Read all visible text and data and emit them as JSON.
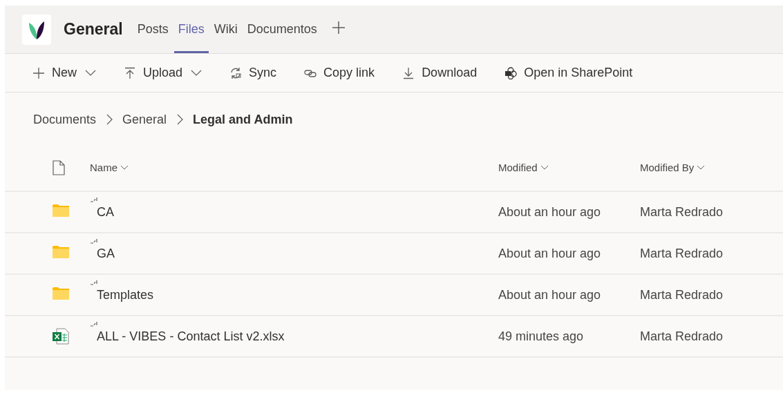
{
  "header": {
    "title": "General"
  },
  "tabs": [
    {
      "label": "Posts",
      "selected": false
    },
    {
      "label": "Files",
      "selected": true
    },
    {
      "label": "Wiki",
      "selected": false
    },
    {
      "label": "Documentos",
      "selected": false
    }
  ],
  "toolbar": [
    {
      "kind": "new",
      "label": "New",
      "dropdown": true
    },
    {
      "kind": "upload",
      "label": "Upload",
      "dropdown": true
    },
    {
      "kind": "sync",
      "label": "Sync",
      "dropdown": false
    },
    {
      "kind": "link",
      "label": "Copy link",
      "dropdown": false
    },
    {
      "kind": "download",
      "label": "Download",
      "dropdown": false
    },
    {
      "kind": "sharepoint",
      "label": "Open in SharePoint",
      "dropdown": false
    }
  ],
  "breadcrumb": [
    {
      "label": "Documents",
      "current": false
    },
    {
      "label": "General",
      "current": false
    },
    {
      "label": "Legal and Admin",
      "current": true
    }
  ],
  "table": {
    "columns": [
      "Name",
      "Modified",
      "Modified By"
    ],
    "rows": [
      {
        "kind": "folder",
        "name": "CA",
        "modified": "About an hour ago",
        "modified_by": "Marta Redrado"
      },
      {
        "kind": "folder",
        "name": "GA",
        "modified": "About an hour ago",
        "modified_by": "Marta Redrado"
      },
      {
        "kind": "folder",
        "name": "Templates",
        "modified": "About an hour ago",
        "modified_by": "Marta Redrado"
      },
      {
        "kind": "excel",
        "name": "ALL - VIBES - Contact List v2.xlsx",
        "modified": "49 minutes ago",
        "modified_by": "Marta Redrado"
      }
    ]
  }
}
